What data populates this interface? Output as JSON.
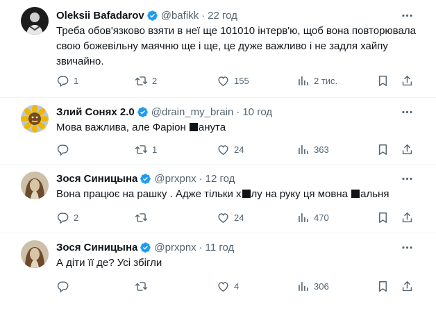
{
  "tweets": [
    {
      "name": "Oleksii Bafadarov",
      "handle": "@bafikk",
      "time": "22 год",
      "text": "Треба обов'язково взяти в неї ще 101010 інтерв'ю, щоб вона повторювала свою божевільну маячню ще і ще, це дуже важливо і не задля хайпу звичайно.",
      "replies": "1",
      "retweets": "2",
      "likes": "155",
      "views": "2 тис."
    },
    {
      "name": "Злий Сонях 2.0",
      "handle": "@drain_my_brain",
      "time": "10 год",
      "text_parts": [
        "Мова важлива, але Фаріон ",
        "анута"
      ],
      "replies": "",
      "retweets": "1",
      "likes": "24",
      "views": "363"
    },
    {
      "name": "Зося Синицына",
      "handle": "@prxpnx",
      "time": "12 год",
      "text_parts": [
        "Вона працює на рашку . Адже тільки х",
        "лу на руку ця мовна ",
        "альня"
      ],
      "replies": "2",
      "retweets": "",
      "likes": "24",
      "views": "470"
    },
    {
      "name": "Зося Синицына",
      "handle": "@prxpnx",
      "time": "11 год",
      "text": "А діти її де? Усі збігли",
      "replies": "",
      "retweets": "",
      "likes": "4",
      "views": "306"
    }
  ],
  "separator": "·",
  "icons": [
    "verified-badge-icon",
    "more-icon",
    "reply-icon",
    "retweet-icon",
    "like-icon",
    "views-icon",
    "bookmark-icon",
    "share-icon"
  ],
  "colors": {
    "verified": "#1d9bf0",
    "muted": "#536471",
    "text": "#0f1419",
    "divider": "#eff3f4"
  }
}
